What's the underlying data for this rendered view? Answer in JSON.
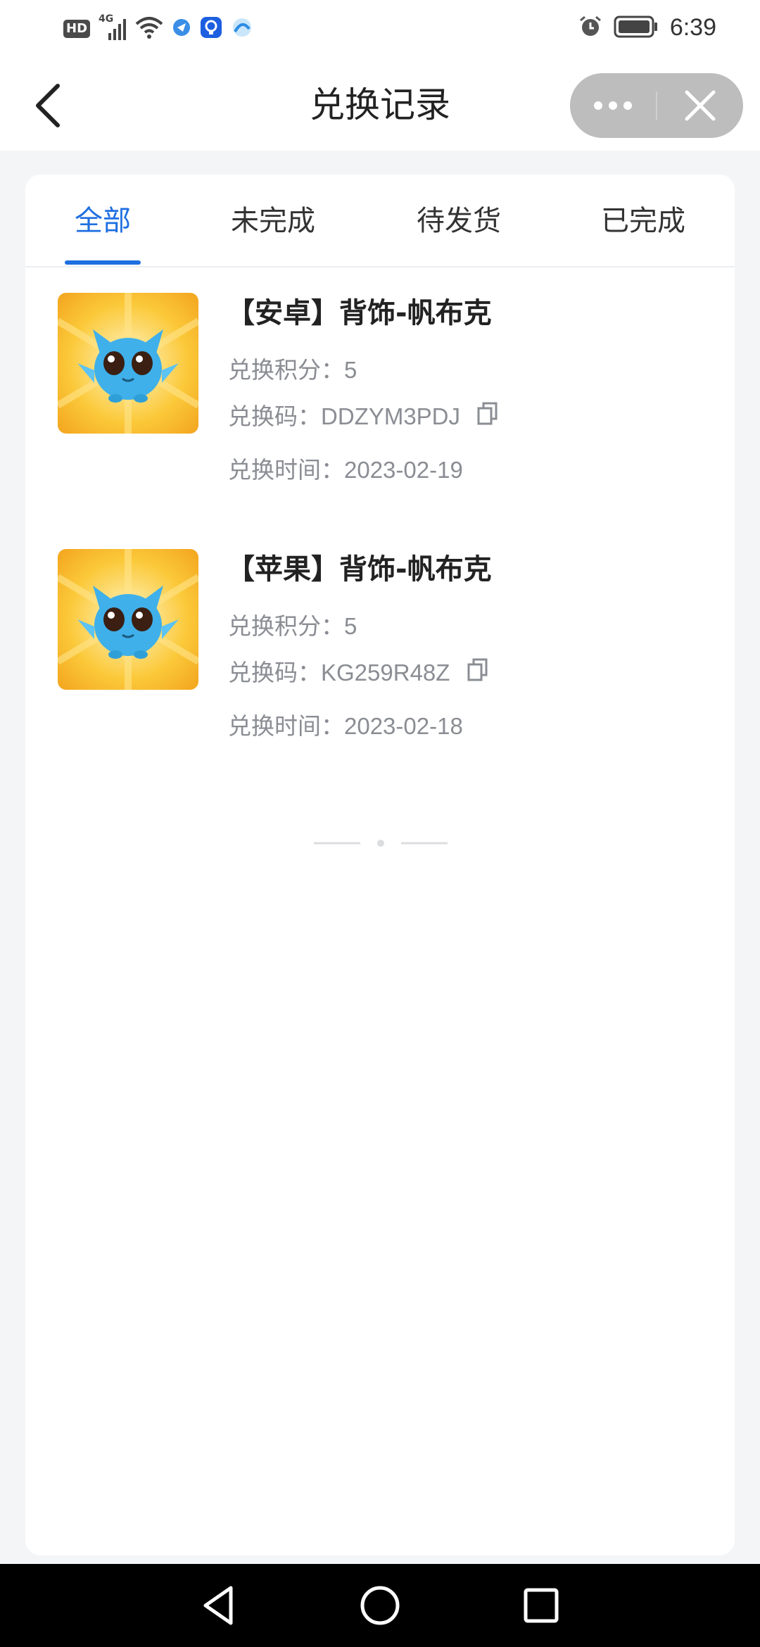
{
  "status_bar": {
    "hd_badge": "HD",
    "network": "4G",
    "time": "6:39",
    "icons": [
      "hd-icon",
      "signal-icon",
      "wifi-icon",
      "app-notification-icon",
      "app-notification-icon",
      "app-notification-icon",
      "alarm-icon",
      "battery-icon"
    ]
  },
  "header": {
    "title": "兑换记录",
    "back_icon": "chevron-left-icon",
    "more_icon": "more-dots-icon",
    "close_icon": "close-icon"
  },
  "tabs": [
    {
      "label": "全部",
      "active": true
    },
    {
      "label": "未完成",
      "active": false
    },
    {
      "label": "待发货",
      "active": false
    },
    {
      "label": "已完成",
      "active": false
    }
  ],
  "records": [
    {
      "title": "【安卓】背饰-帆布克",
      "points_label": "兑换积分：",
      "points": "5",
      "code_label": "兑换码：",
      "code": "DDZYM3PDJ",
      "time_label": "兑换时间：",
      "time": "2023-02-19"
    },
    {
      "title": "【苹果】背饰-帆布克",
      "points_label": "兑换积分：",
      "points": "5",
      "code_label": "兑换码：",
      "code": "KG259R48Z",
      "time_label": "兑换时间：",
      "time": "2023-02-18"
    }
  ],
  "colors": {
    "accent": "#1f6fe0",
    "page_bg": "#f4f5f7",
    "secondary_text": "#8a8d93",
    "capsule_bg": "#bdbdbd",
    "thumb_bg": "#f8b92a",
    "mascot": "#3fb0ea"
  },
  "nav": {
    "icons": [
      "back-triangle-icon",
      "home-circle-icon",
      "recents-square-icon"
    ]
  }
}
